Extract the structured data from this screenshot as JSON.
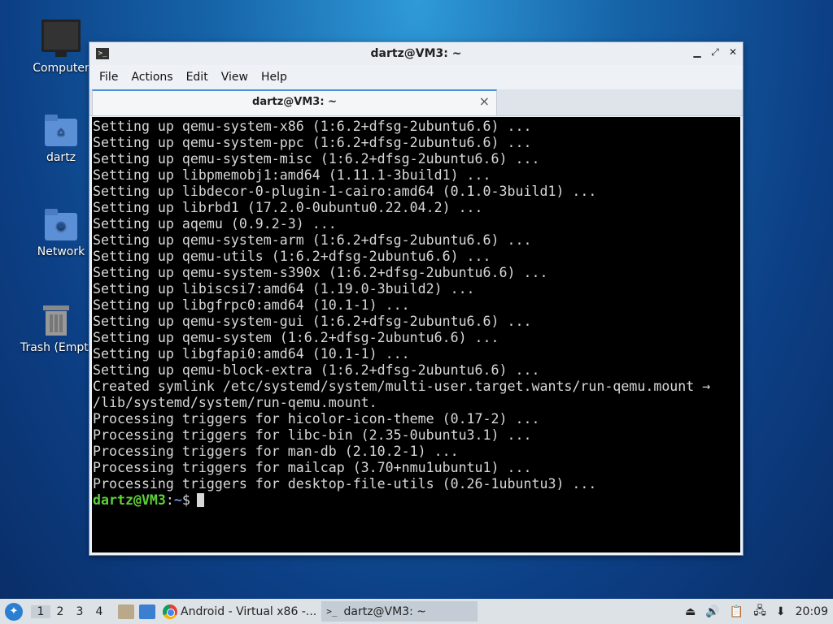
{
  "desktop": {
    "icons": [
      {
        "label": "Computer"
      },
      {
        "label": "dartz"
      },
      {
        "label": "Network"
      },
      {
        "label": "Trash (Empty)"
      }
    ]
  },
  "window": {
    "title": "dartz@VM3: ~",
    "menu": [
      "File",
      "Actions",
      "Edit",
      "View",
      "Help"
    ],
    "tab_label": "dartz@VM3: ~"
  },
  "terminal": {
    "lines": [
      "Setting up qemu-system-x86 (1:6.2+dfsg-2ubuntu6.6) ...",
      "Setting up qemu-system-ppc (1:6.2+dfsg-2ubuntu6.6) ...",
      "Setting up qemu-system-misc (1:6.2+dfsg-2ubuntu6.6) ...",
      "Setting up libpmemobj1:amd64 (1.11.1-3build1) ...",
      "Setting up libdecor-0-plugin-1-cairo:amd64 (0.1.0-3build1) ...",
      "Setting up librbd1 (17.2.0-0ubuntu0.22.04.2) ...",
      "Setting up aqemu (0.9.2-3) ...",
      "Setting up qemu-system-arm (1:6.2+dfsg-2ubuntu6.6) ...",
      "Setting up qemu-utils (1:6.2+dfsg-2ubuntu6.6) ...",
      "Setting up qemu-system-s390x (1:6.2+dfsg-2ubuntu6.6) ...",
      "Setting up libiscsi7:amd64 (1.19.0-3build2) ...",
      "Setting up libgfrpc0:amd64 (10.1-1) ...",
      "Setting up qemu-system-gui (1:6.2+dfsg-2ubuntu6.6) ...",
      "Setting up qemu-system (1:6.2+dfsg-2ubuntu6.6) ...",
      "Setting up libgfapi0:amd64 (10.1-1) ...",
      "Setting up qemu-block-extra (1:6.2+dfsg-2ubuntu6.6) ...",
      "Created symlink /etc/systemd/system/multi-user.target.wants/run-qemu.mount →",
      "/lib/systemd/system/run-qemu.mount.",
      "Processing triggers for hicolor-icon-theme (0.17-2) ...",
      "Processing triggers for libc-bin (2.35-0ubuntu3.1) ...",
      "Processing triggers for man-db (2.10.2-1) ...",
      "Processing triggers for mailcap (3.70+nmu1ubuntu1) ...",
      "Processing triggers for desktop-file-utils (0.26-1ubuntu3) ..."
    ],
    "prompt_user": "dartz@VM3",
    "prompt_sep": ":",
    "prompt_path": "~",
    "prompt_symbol": "$"
  },
  "taskbar": {
    "workspaces": [
      "1",
      "2",
      "3",
      "4"
    ],
    "active_workspace": "1",
    "tasks": [
      {
        "label": "Android - Virtual x86 -...",
        "icon": "chrome-icon"
      },
      {
        "label": "dartz@VM3: ~",
        "icon": "terminal-icon"
      }
    ],
    "clock": "20:09"
  }
}
